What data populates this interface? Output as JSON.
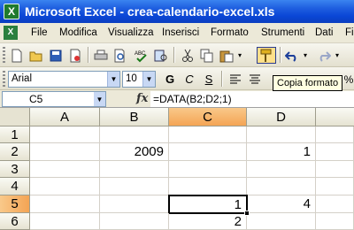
{
  "window": {
    "title": "Microsoft Excel - crea-calendario-excel.xls",
    "app_icon": "X"
  },
  "menu": {
    "doc_icon": "X",
    "items": [
      "File",
      "Modifica",
      "Visualizza",
      "Inserisci",
      "Formato",
      "Strumenti",
      "Dati",
      "Fi"
    ]
  },
  "toolbar_standard": {
    "buttons": [
      "new-icon",
      "open-icon",
      "save-icon",
      "permission-icon",
      "print-icon",
      "print-preview-icon",
      "spelling-icon",
      "research-icon",
      "cut-icon",
      "copy-icon",
      "paste-icon",
      "format-painter-icon",
      "undo-icon",
      "redo-icon"
    ]
  },
  "toolbar_format": {
    "font": "Arial",
    "size": "10",
    "bold": "G",
    "italic": "C",
    "underline": "S",
    "percent": "%"
  },
  "tooltip": "Copia formato",
  "formula_bar": {
    "name_box": "C5",
    "fx": "fx",
    "formula": "=DATA(B2;D2;1)"
  },
  "sheet": {
    "columns": [
      "A",
      "B",
      "C",
      "D"
    ],
    "rows": [
      "1",
      "2",
      "3",
      "4",
      "5",
      "6"
    ],
    "selected_column": "C",
    "selected_row": "5",
    "cells": {
      "B2": "2009",
      "D2": "1",
      "C5": "1",
      "D5": "4",
      "C6": "2"
    }
  },
  "colors": {
    "title_bar": "#0a46d6",
    "selection_header": "#f4a454",
    "tooltip_bg": "#ffffe1"
  }
}
